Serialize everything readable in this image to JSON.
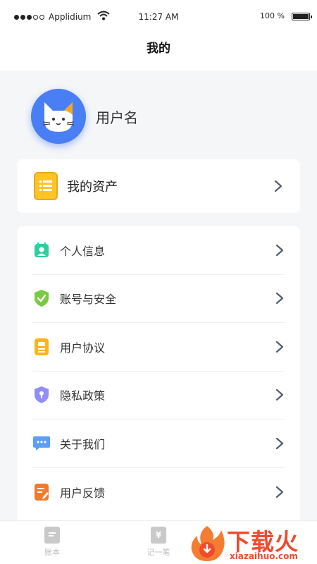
{
  "status_bar": {
    "carrier": "Applidium",
    "time": "11:27 AM",
    "battery": "100 %"
  },
  "nav": {
    "title": "我的"
  },
  "profile": {
    "username": "用户名"
  },
  "asset": {
    "label": "我的资产"
  },
  "menu": [
    {
      "label": "个人信息",
      "icon": "person-card-icon"
    },
    {
      "label": "账号与安全",
      "icon": "shield-check-icon"
    },
    {
      "label": "用户协议",
      "icon": "document-icon"
    },
    {
      "label": "隐私政策",
      "icon": "privacy-shield-icon"
    },
    {
      "label": "关于我们",
      "icon": "chat-bubble-icon"
    },
    {
      "label": "用户反馈",
      "icon": "feedback-edit-icon"
    }
  ],
  "tabbar": {
    "tabs": [
      {
        "label": "账本",
        "icon": "ledger-icon"
      },
      {
        "label": "记一笔",
        "icon": "record-icon"
      }
    ]
  },
  "watermark": {
    "text": "下载火",
    "url": "xiazaihuo.com"
  },
  "colors": {
    "accent_blue": "#4a7ef5",
    "asset_yellow": "#ffc527",
    "watermark_red": "#ef4b2d"
  }
}
